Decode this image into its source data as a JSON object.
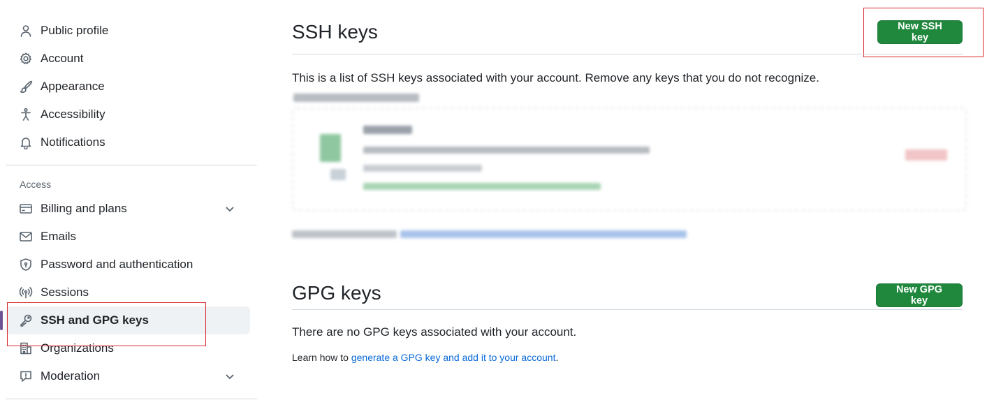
{
  "sidebar": {
    "items_top": [
      {
        "label": "Public profile",
        "icon": "person-icon"
      },
      {
        "label": "Account",
        "icon": "gear-icon"
      },
      {
        "label": "Appearance",
        "icon": "paintbrush-icon"
      },
      {
        "label": "Accessibility",
        "icon": "accessibility-icon"
      },
      {
        "label": "Notifications",
        "icon": "bell-icon"
      }
    ],
    "access_label": "Access",
    "items_access": [
      {
        "label": "Billing and plans",
        "icon": "credit-card-icon"
      },
      {
        "label": "Emails",
        "icon": "mail-icon"
      },
      {
        "label": "Password and authentication",
        "icon": "shield-icon"
      },
      {
        "label": "Sessions",
        "icon": "broadcast-icon"
      },
      {
        "label": "SSH and GPG keys",
        "icon": "key-icon"
      },
      {
        "label": "Organizations",
        "icon": "organization-icon"
      },
      {
        "label": "Moderation",
        "icon": "report-icon"
      }
    ]
  },
  "ssh": {
    "title": "SSH keys",
    "new_button": "New SSH key",
    "description": "This is a list of SSH keys associated with your account. Remove any keys that you do not recognize."
  },
  "gpg": {
    "title": "GPG keys",
    "new_button": "New GPG key",
    "empty": "There are no GPG keys associated with your account.",
    "learn_prefix": "Learn how to ",
    "learn_link": "generate a GPG key and add it to your account",
    "learn_suffix": "."
  },
  "colors": {
    "primary_button": "#1f883d",
    "link": "#0969da",
    "highlight": "#d9252b",
    "selected_bar": "#6e5494"
  }
}
